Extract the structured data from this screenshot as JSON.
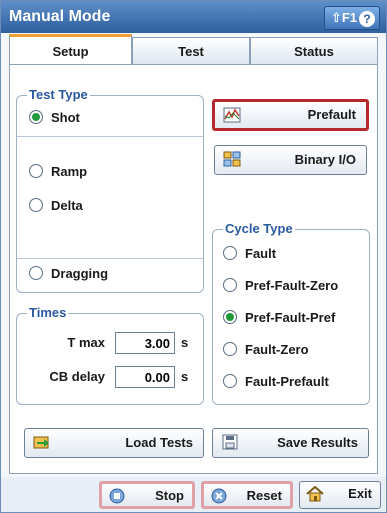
{
  "window": {
    "title": "Manual Mode",
    "help_label": "⇧F1",
    "help_icon": "?"
  },
  "tabs": [
    {
      "label": "Setup",
      "active": true
    },
    {
      "label": "Test",
      "active": false
    },
    {
      "label": "Status",
      "active": false
    }
  ],
  "test_type": {
    "title": "Test Type",
    "options": [
      {
        "label": "Shot",
        "checked": true
      },
      {
        "label": "Ramp",
        "checked": false
      },
      {
        "label": "Delta",
        "checked": false
      },
      {
        "label": "Dragging",
        "checked": false
      }
    ]
  },
  "buttons": {
    "prefault": "Prefault",
    "binary_io": "Binary I/O",
    "load_tests": "Load Tests",
    "save_results": "Save Results"
  },
  "cycle_type": {
    "title": "Cycle Type",
    "options": [
      {
        "label": "Fault",
        "checked": false
      },
      {
        "label": "Pref-Fault-Zero",
        "checked": false
      },
      {
        "label": "Pref-Fault-Pref",
        "checked": true
      },
      {
        "label": "Fault-Zero",
        "checked": false
      },
      {
        "label": "Fault-Prefault",
        "checked": false
      }
    ]
  },
  "times": {
    "title": "Times",
    "t_max": {
      "label": "T max",
      "value": "3.00",
      "unit": "s"
    },
    "cb_delay": {
      "label": "CB delay",
      "value": "0.00",
      "unit": "s"
    }
  },
  "bottom": {
    "stop": "Stop",
    "reset": "Reset",
    "exit": "Exit"
  },
  "colors": {
    "accent": "#2e5f9f",
    "checked": "#1f9b3b",
    "highlight": "#b5282c"
  }
}
